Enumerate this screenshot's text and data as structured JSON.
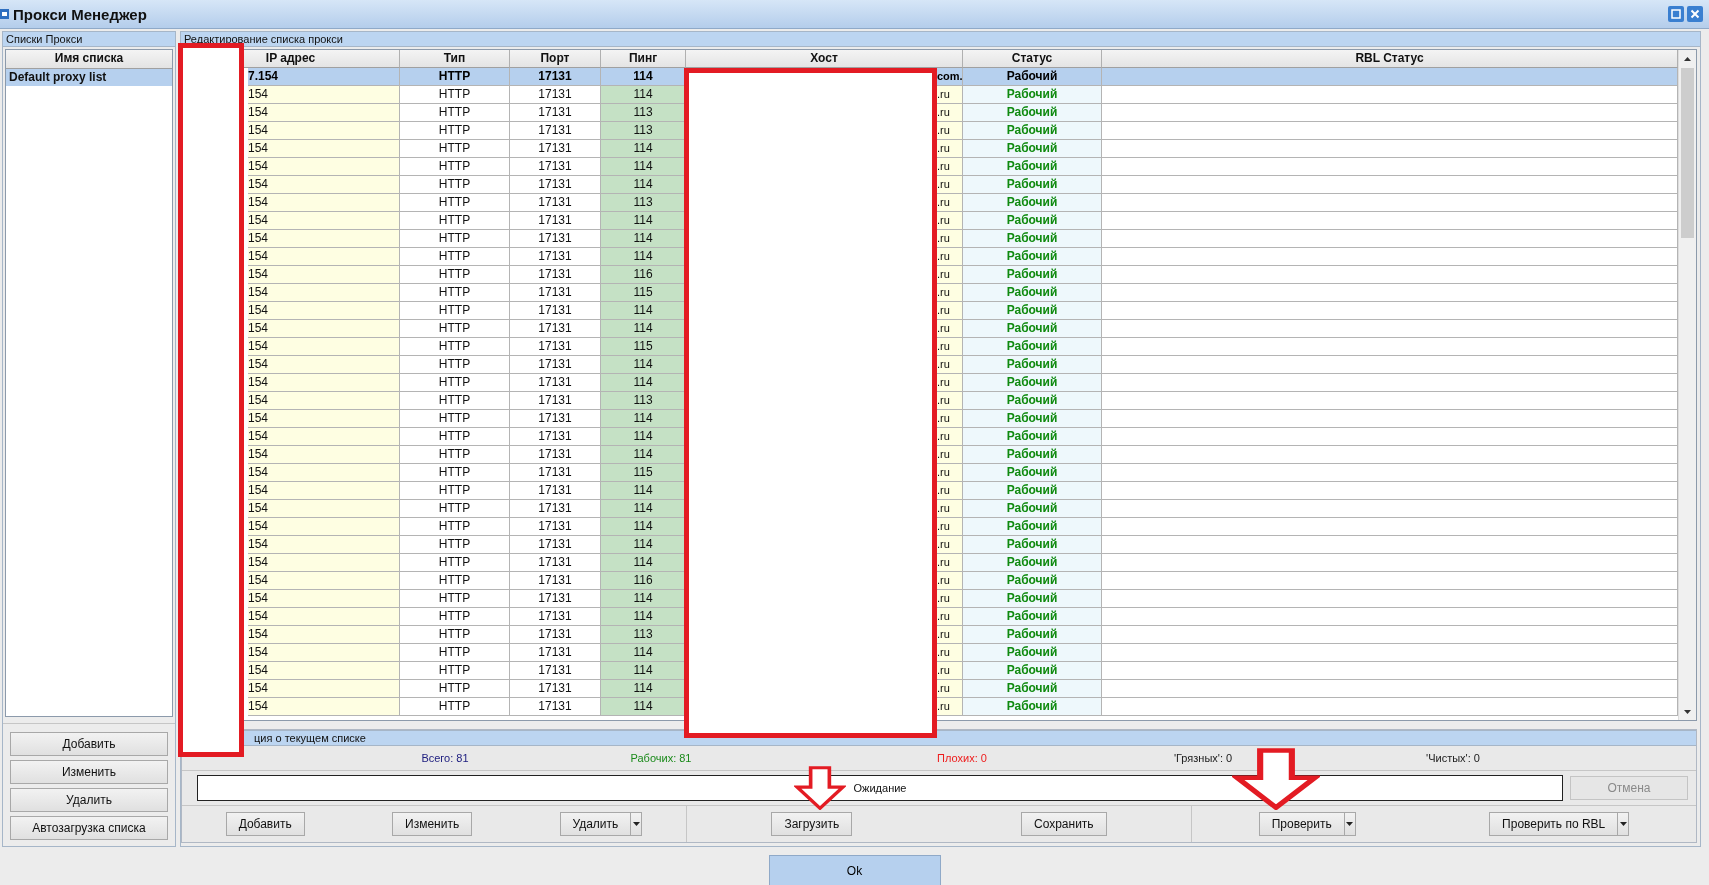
{
  "window": {
    "title": "Прокси Менеджер"
  },
  "lists_panel": {
    "title": "Списки Прокси",
    "column": "Имя списка",
    "items": [
      {
        "name": "Default proxy list",
        "selected": true
      }
    ],
    "buttons": [
      "Добавить",
      "Изменить",
      "Удалить",
      "Автозагрузка списка"
    ]
  },
  "editor": {
    "title": "Редактирование списка прокси",
    "columns": [
      "IP адрес",
      "Тип",
      "Порт",
      "Пинг",
      "Хост",
      "Статус",
      "RBL Статус"
    ],
    "rows": [
      {
        "ip": "7.154",
        "type": "HTTP",
        "port": "17131",
        "ping": "114",
        "host": "com.",
        "status": "Рабочий",
        "selected": true
      },
      {
        "ip": "154",
        "type": "HTTP",
        "port": "17131",
        "ping": "114",
        "host": ".ru",
        "status": "Рабочий",
        "selected": false
      },
      {
        "ip": "154",
        "type": "HTTP",
        "port": "17131",
        "ping": "113",
        "host": ".ru",
        "status": "Рабочий",
        "selected": false
      },
      {
        "ip": "154",
        "type": "HTTP",
        "port": "17131",
        "ping": "113",
        "host": ".ru",
        "status": "Рабочий",
        "selected": false
      },
      {
        "ip": "154",
        "type": "HTTP",
        "port": "17131",
        "ping": "114",
        "host": ".ru",
        "status": "Рабочий",
        "selected": false
      },
      {
        "ip": "154",
        "type": "HTTP",
        "port": "17131",
        "ping": "114",
        "host": ".ru",
        "status": "Рабочий",
        "selected": false
      },
      {
        "ip": "154",
        "type": "HTTP",
        "port": "17131",
        "ping": "114",
        "host": ".ru",
        "status": "Рабочий",
        "selected": false
      },
      {
        "ip": "154",
        "type": "HTTP",
        "port": "17131",
        "ping": "113",
        "host": ".ru",
        "status": "Рабочий",
        "selected": false
      },
      {
        "ip": "154",
        "type": "HTTP",
        "port": "17131",
        "ping": "114",
        "host": ".ru",
        "status": "Рабочий",
        "selected": false
      },
      {
        "ip": "154",
        "type": "HTTP",
        "port": "17131",
        "ping": "114",
        "host": ".ru",
        "status": "Рабочий",
        "selected": false
      },
      {
        "ip": "154",
        "type": "HTTP",
        "port": "17131",
        "ping": "114",
        "host": ".ru",
        "status": "Рабочий",
        "selected": false
      },
      {
        "ip": "154",
        "type": "HTTP",
        "port": "17131",
        "ping": "116",
        "host": ".ru",
        "status": "Рабочий",
        "selected": false
      },
      {
        "ip": "154",
        "type": "HTTP",
        "port": "17131",
        "ping": "115",
        "host": ".ru",
        "status": "Рабочий",
        "selected": false
      },
      {
        "ip": "154",
        "type": "HTTP",
        "port": "17131",
        "ping": "114",
        "host": ".ru",
        "status": "Рабочий",
        "selected": false
      },
      {
        "ip": "154",
        "type": "HTTP",
        "port": "17131",
        "ping": "114",
        "host": ".ru",
        "status": "Рабочий",
        "selected": false
      },
      {
        "ip": "154",
        "type": "HTTP",
        "port": "17131",
        "ping": "115",
        "host": ".ru",
        "status": "Рабочий",
        "selected": false
      },
      {
        "ip": "154",
        "type": "HTTP",
        "port": "17131",
        "ping": "114",
        "host": ".ru",
        "status": "Рабочий",
        "selected": false
      },
      {
        "ip": "154",
        "type": "HTTP",
        "port": "17131",
        "ping": "114",
        "host": ".ru",
        "status": "Рабочий",
        "selected": false
      },
      {
        "ip": "154",
        "type": "HTTP",
        "port": "17131",
        "ping": "113",
        "host": ".ru",
        "status": "Рабочий",
        "selected": false
      },
      {
        "ip": "154",
        "type": "HTTP",
        "port": "17131",
        "ping": "114",
        "host": ".ru",
        "status": "Рабочий",
        "selected": false
      },
      {
        "ip": "154",
        "type": "HTTP",
        "port": "17131",
        "ping": "114",
        "host": ".ru",
        "status": "Рабочий",
        "selected": false
      },
      {
        "ip": "154",
        "type": "HTTP",
        "port": "17131",
        "ping": "114",
        "host": ".ru",
        "status": "Рабочий",
        "selected": false
      },
      {
        "ip": "154",
        "type": "HTTP",
        "port": "17131",
        "ping": "115",
        "host": ".ru",
        "status": "Рабочий",
        "selected": false
      },
      {
        "ip": "154",
        "type": "HTTP",
        "port": "17131",
        "ping": "114",
        "host": ".ru",
        "status": "Рабочий",
        "selected": false
      },
      {
        "ip": "154",
        "type": "HTTP",
        "port": "17131",
        "ping": "114",
        "host": ".ru",
        "status": "Рабочий",
        "selected": false
      },
      {
        "ip": "154",
        "type": "HTTP",
        "port": "17131",
        "ping": "114",
        "host": ".ru",
        "status": "Рабочий",
        "selected": false
      },
      {
        "ip": "154",
        "type": "HTTP",
        "port": "17131",
        "ping": "114",
        "host": ".ru",
        "status": "Рабочий",
        "selected": false
      },
      {
        "ip": "154",
        "type": "HTTP",
        "port": "17131",
        "ping": "114",
        "host": ".ru",
        "status": "Рабочий",
        "selected": false
      },
      {
        "ip": "154",
        "type": "HTTP",
        "port": "17131",
        "ping": "116",
        "host": ".ru",
        "status": "Рабочий",
        "selected": false
      },
      {
        "ip": "154",
        "type": "HTTP",
        "port": "17131",
        "ping": "114",
        "host": ".ru",
        "status": "Рабочий",
        "selected": false
      },
      {
        "ip": "154",
        "type": "HTTP",
        "port": "17131",
        "ping": "114",
        "host": ".ru",
        "status": "Рабочий",
        "selected": false
      },
      {
        "ip": "154",
        "type": "HTTP",
        "port": "17131",
        "ping": "113",
        "host": ".ru",
        "status": "Рабочий",
        "selected": false
      },
      {
        "ip": "154",
        "type": "HTTP",
        "port": "17131",
        "ping": "114",
        "host": ".ru",
        "status": "Рабочий",
        "selected": false
      },
      {
        "ip": "154",
        "type": "HTTP",
        "port": "17131",
        "ping": "114",
        "host": ".ru",
        "status": "Рабочий",
        "selected": false
      },
      {
        "ip": "154",
        "type": "HTTP",
        "port": "17131",
        "ping": "114",
        "host": ".ru",
        "status": "Рабочий",
        "selected": false
      },
      {
        "ip": "154",
        "type": "HTTP",
        "port": "17131",
        "ping": "114",
        "host": ".ru",
        "status": "Рабочий",
        "selected": false
      }
    ]
  },
  "info": {
    "title": "ция о текущем списке",
    "stats": [
      {
        "text": "Всего: 81",
        "color": "#202080"
      },
      {
        "text": "Рабочих: 81",
        "color": "#1a8a1a"
      },
      {
        "text": "Плохих: 0",
        "color": "#ee1c1c"
      },
      {
        "text": "'Грязных': 0",
        "color": "#202020"
      },
      {
        "text": "'Чистых': 0",
        "color": "#202020"
      }
    ],
    "progress_status": "Ожидание",
    "cancel": {
      "label": "Отмена",
      "disabled": true
    },
    "button_groups": [
      [
        {
          "label": "Добавить",
          "dropdown": false
        },
        {
          "label": "Изменить",
          "dropdown": false
        },
        {
          "label": "Удалить",
          "dropdown": true
        }
      ],
      [
        {
          "label": "Загрузить",
          "dropdown": false
        },
        {
          "label": "Сохранить",
          "dropdown": false
        }
      ],
      [
        {
          "label": "Проверить",
          "dropdown": true
        },
        {
          "label": "Проверить по RBL",
          "dropdown": true
        }
      ]
    ]
  },
  "ok_button": "Ok",
  "annotations": [
    {
      "kind": "redaction"
    },
    {
      "kind": "redaction"
    },
    {
      "kind": "arrow"
    },
    {
      "kind": "arrow"
    }
  ]
}
